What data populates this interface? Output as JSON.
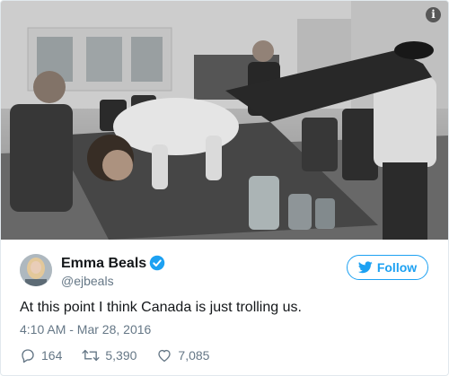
{
  "tweet": {
    "display_name": "Emma Beals",
    "handle": "@ejbeals",
    "verified": true,
    "follow_label": "Follow",
    "text": "At this point I think Canada is just trolling us.",
    "timestamp": "4:10 AM - Mar 28, 2016",
    "replies": "164",
    "retweets": "5,390",
    "likes": "7,085"
  },
  "media": {
    "info_glyph": "i",
    "icons": [
      "info-icon"
    ]
  },
  "colors": {
    "brand": "#1da1f2",
    "secondary_text": "#657786",
    "primary_text": "#14171a"
  }
}
